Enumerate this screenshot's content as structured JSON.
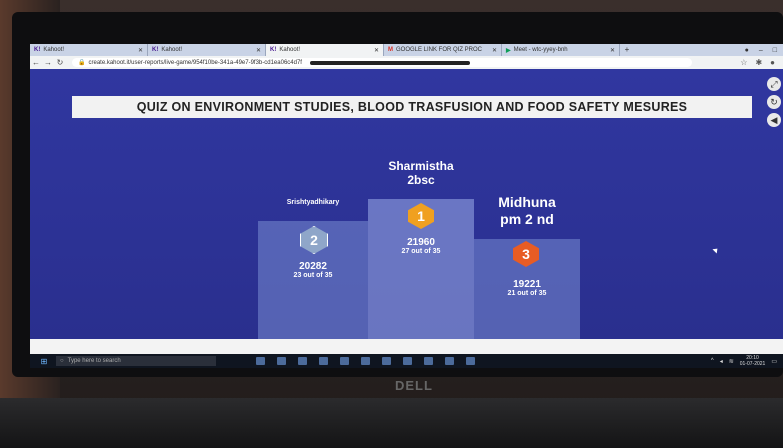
{
  "browser": {
    "tabs": [
      {
        "label": "Kahoot!",
        "icon": "kahoot-icon"
      },
      {
        "label": "Kahoot!",
        "icon": "kahoot-icon"
      },
      {
        "label": "Kahoot!",
        "icon": "kahoot-icon",
        "active": true
      },
      {
        "label": "GOOGLE LINK FOR QIZ PROC",
        "icon": "gmail-icon"
      },
      {
        "label": "Meet - wtc-yyey-bnh",
        "icon": "meet-icon"
      }
    ],
    "url": "create.kahoot.it/user-reports/live-game/954f10be-341a-49e7-9f3b-cd1ea06c4d7f"
  },
  "quiz": {
    "title": "QUIZ ON ENVIRONMENT STUDIES, BLOOD TRASFUSION AND FOOD SAFETY MESURES"
  },
  "podium": {
    "first": {
      "name_line1": "Sharmistha",
      "name_line2": "2bsc",
      "rank": "1",
      "points": "21960",
      "correct": "27 out of 35",
      "color": "#f0a020"
    },
    "second": {
      "name": "Srishtyadhikary",
      "rank": "2",
      "points": "20282",
      "correct": "23 out of 35",
      "color": "#8fa6c9"
    },
    "third": {
      "name_line1": "Midhuna",
      "name_line2": "pm 2 nd",
      "rank": "3",
      "points": "19221",
      "correct": "21 out of 35",
      "color": "#e85c24"
    }
  },
  "taskbar": {
    "search_placeholder": "Type here to search",
    "time": "20:10",
    "date": "01-07-2021"
  },
  "hardware": {
    "brand": "DELL"
  }
}
